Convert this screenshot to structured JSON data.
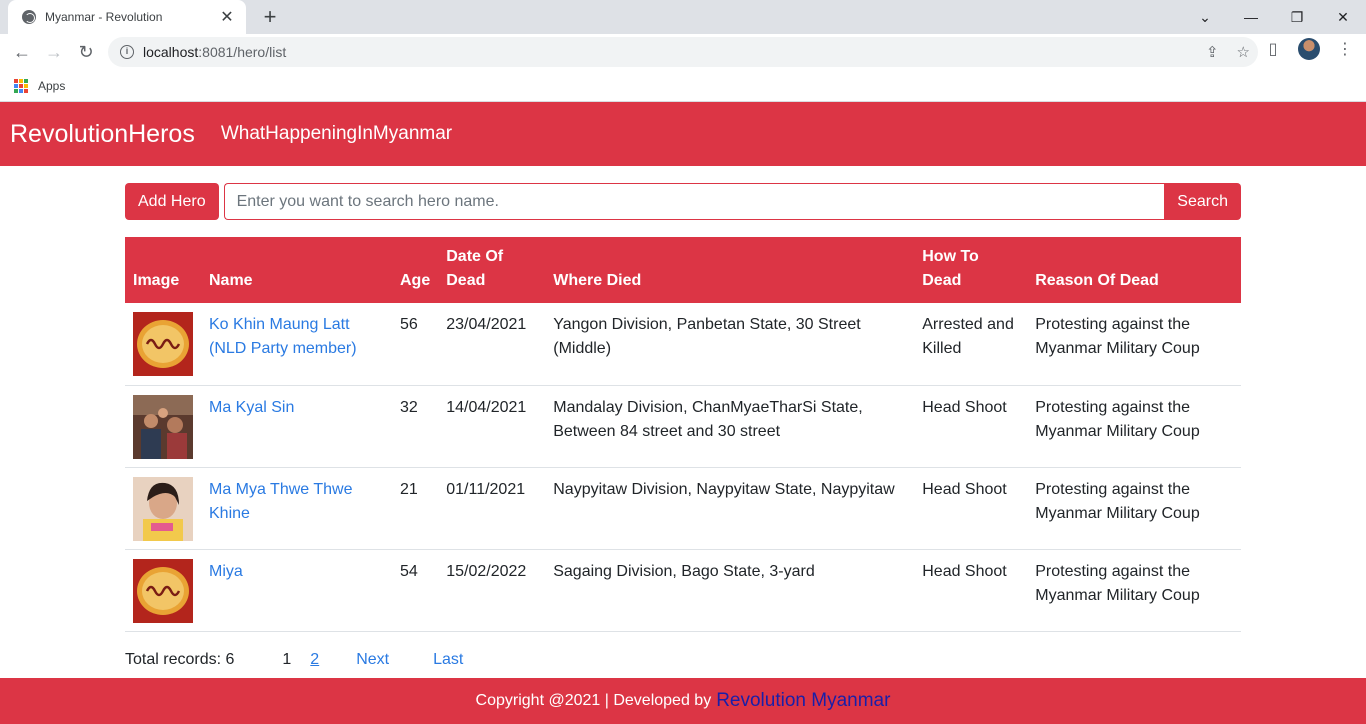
{
  "browser": {
    "tab_title": "Myanmar - Revolution",
    "url_host": "localhost",
    "url_rest": ":8081/hero/list",
    "bookmark_apps": "Apps"
  },
  "navbar": {
    "brand": "RevolutionHeros",
    "link": "WhatHappeningInMyanmar"
  },
  "toolbar": {
    "add_label": "Add Hero",
    "search_placeholder": "Enter you want to search hero name.",
    "search_label": "Search"
  },
  "table": {
    "headers": {
      "image": "Image",
      "name": "Name",
      "age": "Age",
      "date_line1": "Date Of",
      "date_line2": "Dead",
      "where": "Where Died",
      "how_line1": "How To",
      "how_line2": "Dead",
      "reason": "Reason Of Dead"
    },
    "rows": [
      {
        "name": "Ko Khin Maung Latt (NLD Party member)",
        "age": "56",
        "date": "23/04/2021",
        "where": "Yangon Division, Panbetan State, 30 Street (Middle)",
        "how": "Arrested and Killed",
        "reason": "Protesting against the Myanmar Military Coup"
      },
      {
        "name": "Ma Kyal Sin",
        "age": "32",
        "date": "14/04/2021",
        "where": "Mandalay Division, ChanMyaeTharSi State, Between 84 street and 30 street",
        "how": "Head Shoot",
        "reason": "Protesting against the Myanmar Military Coup"
      },
      {
        "name": "Ma Mya Thwe Thwe Khine",
        "age": "21",
        "date": "01/11/2021",
        "where": "Naypyitaw Division, Naypyitaw State, Naypyitaw",
        "how": "Head Shoot",
        "reason": "Protesting against the Myanmar Military Coup"
      },
      {
        "name": "Miya",
        "age": "54",
        "date": "15/02/2022",
        "where": "Sagaing Division, Bago State, 3-yard",
        "how": "Head Shoot",
        "reason": "Protesting against the Myanmar Military Coup"
      }
    ]
  },
  "pager": {
    "total": "Total records: 6",
    "current": "1",
    "page2": "2",
    "next": "Next",
    "last": "Last"
  },
  "footer": {
    "text": "Copyright @2021 | Developed by",
    "link": "Revolution Myanmar"
  },
  "colors": {
    "primary": "#dc3545",
    "link": "#2a7ae2",
    "footer_link": "#1a1fa8"
  }
}
